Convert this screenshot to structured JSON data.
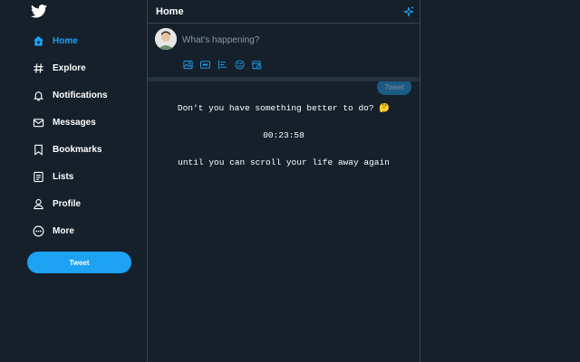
{
  "sidebar": {
    "items": [
      {
        "label": "Home",
        "icon": "home-icon",
        "active": true
      },
      {
        "label": "Explore",
        "icon": "hashtag-icon"
      },
      {
        "label": "Notifications",
        "icon": "bell-icon"
      },
      {
        "label": "Messages",
        "icon": "mail-icon"
      },
      {
        "label": "Bookmarks",
        "icon": "bookmark-icon"
      },
      {
        "label": "Lists",
        "icon": "list-icon"
      },
      {
        "label": "Profile",
        "icon": "person-icon"
      },
      {
        "label": "More",
        "icon": "more-icon"
      }
    ],
    "tweet_label": "Tweet"
  },
  "header": {
    "title": "Home"
  },
  "compose": {
    "placeholder": "What's happening?",
    "tweet_label": "Tweet"
  },
  "message": {
    "line1": "Don't you have something better to do? 🤔",
    "timer": "00:23:58",
    "line3": "until you can scroll your life away again"
  },
  "colors": {
    "background": "#15202b",
    "accent": "#1da1f2",
    "border": "#38444d"
  }
}
